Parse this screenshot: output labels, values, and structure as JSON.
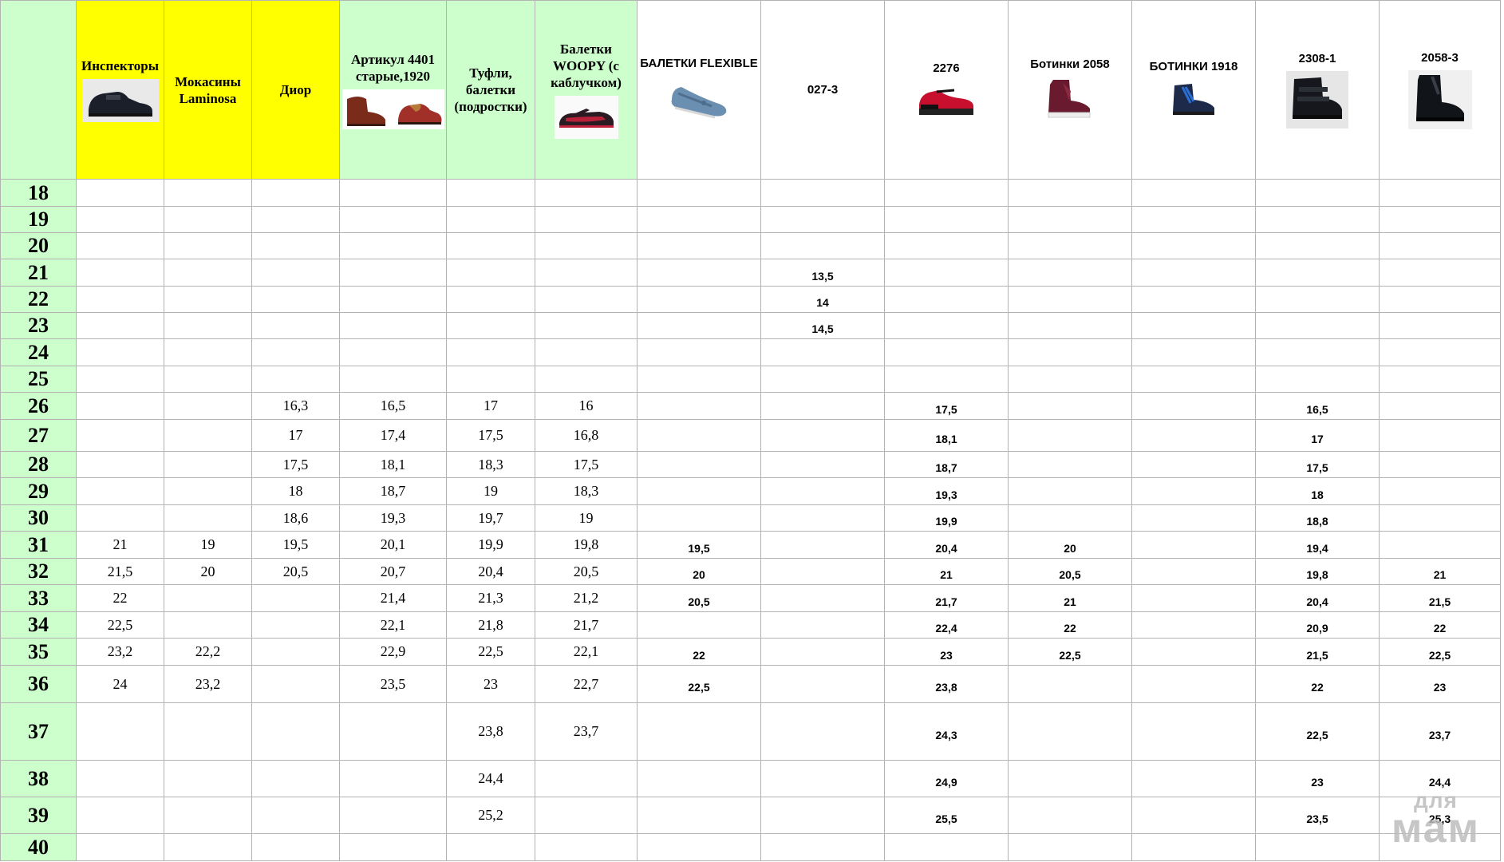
{
  "columns": [
    {
      "label": "Инспекторы",
      "bg": "yellow",
      "font": "serif",
      "image": "black-school-shoe-icon"
    },
    {
      "label": "Мокасины Laminosa",
      "bg": "yellow",
      "font": "serif",
      "image": ""
    },
    {
      "label": "Диор",
      "bg": "yellow",
      "font": "serif",
      "image": ""
    },
    {
      "label": "Артикул 4401 старые,1920",
      "bg": "green",
      "font": "serif",
      "image": "two-shoes-icon"
    },
    {
      "label": "Туфли, балетки (подростки)",
      "bg": "green",
      "font": "serif",
      "image": ""
    },
    {
      "label": "Балетки WOOPY (с каблучком)",
      "bg": "green",
      "font": "serif",
      "image": "red-ballet-flat-icon"
    },
    {
      "label": "БАЛЕТКИ FLEXIBLE",
      "bg": "white",
      "font": "sans",
      "image": "blue-ballet-flat-icon"
    },
    {
      "label": "027-3",
      "bg": "white",
      "font": "sans",
      "image": ""
    },
    {
      "label": "2276",
      "bg": "white",
      "font": "sans",
      "image": "red-mary-jane-icon"
    },
    {
      "label": "Ботинки 2058",
      "bg": "white",
      "font": "sans",
      "image": "burgundy-boot-icon"
    },
    {
      "label": "БОТИНКИ 1918",
      "bg": "white",
      "font": "sans",
      "image": "blue-lace-boot-icon"
    },
    {
      "label": "2308-1",
      "bg": "white",
      "font": "sans",
      "image": "black-velcro-boot-icon"
    },
    {
      "label": "2058-3",
      "bg": "white",
      "font": "sans",
      "image": "black-chelsea-boot-icon"
    }
  ],
  "rows": [
    {
      "size": "18",
      "values": [
        "",
        "",
        "",
        "",
        "",
        "",
        "",
        "",
        "",
        "",
        "",
        "",
        ""
      ]
    },
    {
      "size": "19",
      "values": [
        "",
        "",
        "",
        "",
        "",
        "",
        "",
        "",
        "",
        "",
        "",
        "",
        ""
      ]
    },
    {
      "size": "20",
      "values": [
        "",
        "",
        "",
        "",
        "",
        "",
        "",
        "",
        "",
        "",
        "",
        "",
        ""
      ]
    },
    {
      "size": "21",
      "values": [
        "",
        "",
        "",
        "",
        "",
        "",
        "",
        "13,5",
        "",
        "",
        "",
        "",
        ""
      ]
    },
    {
      "size": "22",
      "values": [
        "",
        "",
        "",
        "",
        "",
        "",
        "",
        "14",
        "",
        "",
        "",
        "",
        ""
      ]
    },
    {
      "size": "23",
      "values": [
        "",
        "",
        "",
        "",
        "",
        "",
        "",
        "14,5",
        "",
        "",
        "",
        "",
        ""
      ]
    },
    {
      "size": "24",
      "values": [
        "",
        "",
        "",
        "",
        "",
        "",
        "",
        "",
        "",
        "",
        "",
        "",
        ""
      ]
    },
    {
      "size": "25",
      "values": [
        "",
        "",
        "",
        "",
        "",
        "",
        "",
        "",
        "",
        "",
        "",
        "",
        ""
      ]
    },
    {
      "size": "26",
      "values": [
        "",
        "",
        "16,3",
        "16,5",
        "17",
        "16",
        "",
        "",
        "17,5",
        "",
        "",
        "16,5",
        ""
      ]
    },
    {
      "size": "27",
      "values": [
        "",
        "",
        "17",
        "17,4",
        "17,5",
        "16,8",
        "",
        "",
        "18,1",
        "",
        "",
        "17",
        ""
      ]
    },
    {
      "size": "28",
      "values": [
        "",
        "",
        "17,5",
        "18,1",
        "18,3",
        "17,5",
        "",
        "",
        "18,7",
        "",
        "",
        "17,5",
        ""
      ]
    },
    {
      "size": "29",
      "values": [
        "",
        "",
        "18",
        "18,7",
        "19",
        "18,3",
        "",
        "",
        "19,3",
        "",
        "",
        "18",
        ""
      ]
    },
    {
      "size": "30",
      "values": [
        "",
        "",
        "18,6",
        "19,3",
        "19,7",
        "19",
        "",
        "",
        "19,9",
        "",
        "",
        "18,8",
        ""
      ]
    },
    {
      "size": "31",
      "values": [
        "21",
        "19",
        "19,5",
        "20,1",
        "19,9",
        "19,8",
        "19,5",
        "",
        "20,4",
        "20",
        "",
        "19,4",
        ""
      ]
    },
    {
      "size": "32",
      "values": [
        "21,5",
        "20",
        "20,5",
        "20,7",
        "20,4",
        "20,5",
        "20",
        "",
        "21",
        "20,5",
        "",
        "19,8",
        "21"
      ]
    },
    {
      "size": "33",
      "values": [
        "22",
        "",
        "",
        "21,4",
        "21,3",
        "21,2",
        "20,5",
        "",
        "21,7",
        "21",
        "",
        "20,4",
        "21,5"
      ]
    },
    {
      "size": "34",
      "values": [
        "22,5",
        "",
        "",
        "22,1",
        "21,8",
        "21,7",
        "",
        "",
        "22,4",
        "22",
        "",
        "20,9",
        "22"
      ]
    },
    {
      "size": "35",
      "values": [
        "23,2",
        "22,2",
        "",
        "22,9",
        "22,5",
        "22,1",
        "22",
        "",
        "23",
        "22,5",
        "",
        "21,5",
        "22,5"
      ]
    },
    {
      "size": "36",
      "values": [
        "24",
        "23,2",
        "",
        "23,5",
        "23",
        "22,7",
        "22,5",
        "",
        "23,8",
        "",
        "",
        "22",
        "23"
      ]
    },
    {
      "size": "37",
      "values": [
        "",
        "",
        "",
        "",
        "23,8",
        "23,7",
        "",
        "",
        "24,3",
        "",
        "",
        "22,5",
        "23,7"
      ]
    },
    {
      "size": "38",
      "values": [
        "",
        "",
        "",
        "",
        "24,4",
        "",
        "",
        "",
        "24,9",
        "",
        "",
        "23",
        "24,4"
      ]
    },
    {
      "size": "39",
      "values": [
        "",
        "",
        "",
        "",
        "25,2",
        "",
        "",
        "",
        "25,5",
        "",
        "",
        "23,5",
        "25,3"
      ]
    },
    {
      "size": "40",
      "values": [
        "",
        "",
        "",
        "",
        "",
        "",
        "",
        "",
        "",
        "",
        "",
        "",
        ""
      ]
    }
  ],
  "watermark": {
    "line1": "для",
    "line2": "мам"
  },
  "colors": {
    "yellow": "#ffff00",
    "green": "#ccffcc",
    "white": "#ffffff",
    "grid": "#b3b3b3"
  }
}
